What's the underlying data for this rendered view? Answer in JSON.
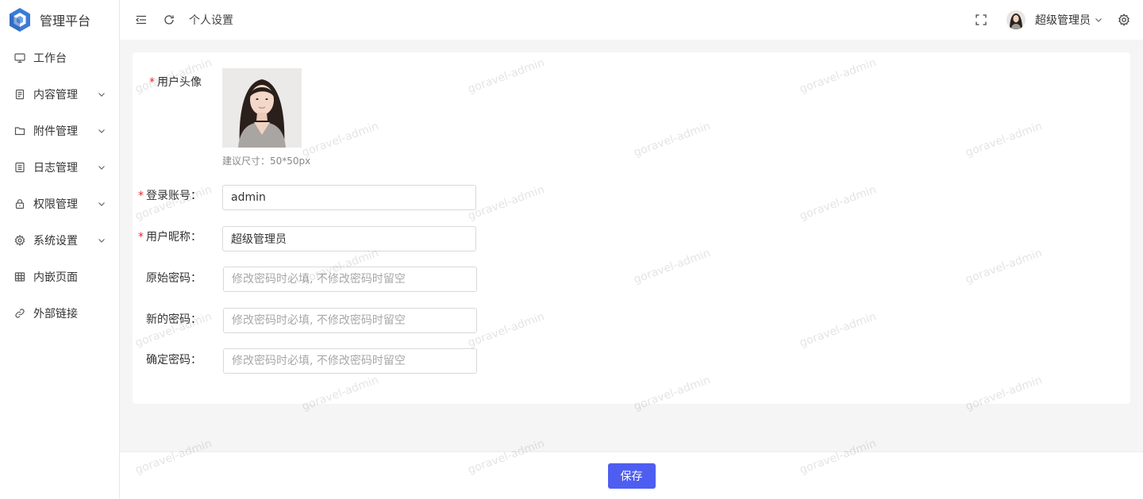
{
  "app": {
    "title": "管理平台",
    "accent": "#4e5ef0",
    "logo_color": "#3b7bd8"
  },
  "sidebar": {
    "items": [
      {
        "label": "工作台",
        "icon": "monitor-icon",
        "has_children": false
      },
      {
        "label": "内容管理",
        "icon": "document-icon",
        "has_children": true
      },
      {
        "label": "附件管理",
        "icon": "folder-icon",
        "has_children": true
      },
      {
        "label": "日志管理",
        "icon": "list-icon",
        "has_children": true
      },
      {
        "label": "权限管理",
        "icon": "lock-icon",
        "has_children": true
      },
      {
        "label": "系统设置",
        "icon": "gear-icon",
        "has_children": true
      },
      {
        "label": "内嵌页面",
        "icon": "table-icon",
        "has_children": false
      },
      {
        "label": "外部链接",
        "icon": "link-icon",
        "has_children": false
      }
    ]
  },
  "header": {
    "page_title": "个人设置",
    "user_name": "超级管理员",
    "icons": [
      "menu-fold-icon",
      "refresh-icon",
      "fullscreen-icon",
      "settings-icon"
    ]
  },
  "form": {
    "avatar": {
      "label": "用户头像",
      "required": true,
      "hint": "建议尺寸：50*50px"
    },
    "account": {
      "label": "登录账号：",
      "required": true,
      "value": "admin"
    },
    "nickname": {
      "label": "用户昵称：",
      "required": true,
      "value": "超级管理员"
    },
    "old_password": {
      "label": "原始密码：",
      "required": false,
      "placeholder": "修改密码时必填, 不修改密码时留空"
    },
    "new_password": {
      "label": "新的密码：",
      "required": false,
      "placeholder": "修改密码时必填, 不修改密码时留空"
    },
    "confirm_password": {
      "label": "确定密码：",
      "required": false,
      "placeholder": "修改密码时必填, 不修改密码时留空"
    }
  },
  "footer": {
    "save_label": "保存"
  },
  "watermark": {
    "text": "goravel-admin"
  }
}
